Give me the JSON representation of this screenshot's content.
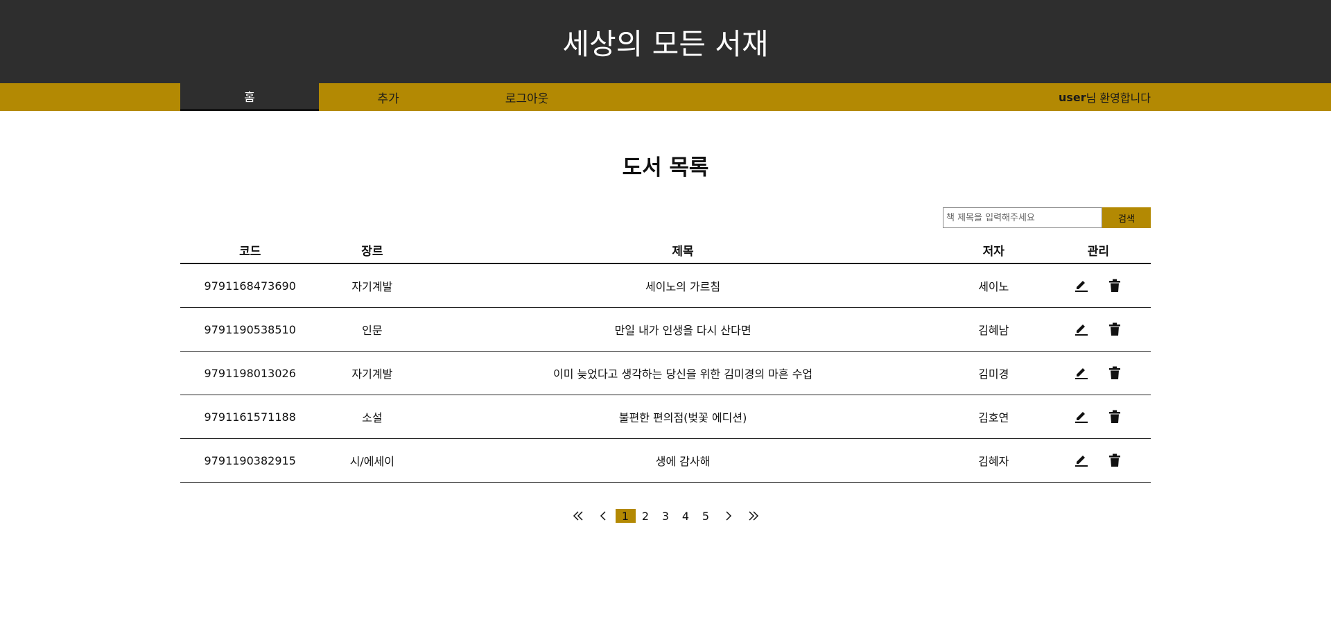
{
  "site": {
    "title": "세상의 모든 서재"
  },
  "nav": {
    "items": [
      {
        "label": "홈"
      },
      {
        "label": "추가"
      },
      {
        "label": "로그아웃"
      }
    ],
    "user": "user",
    "welcome_suffix": "님 환영합니다"
  },
  "main": {
    "heading": "도서 목록",
    "search": {
      "placeholder": "책 제목을 입력해주세요",
      "value": "",
      "button_label": "검색"
    },
    "table": {
      "headers": [
        "코드",
        "장르",
        "제목",
        "저자",
        "관리"
      ],
      "rows": [
        {
          "code": "9791168473690",
          "genre": "자기계발",
          "title": "세이노의 가르침",
          "author": "세이노"
        },
        {
          "code": "9791190538510",
          "genre": "인문",
          "title": "만일 내가 인생을 다시 산다면",
          "author": "김혜남"
        },
        {
          "code": "9791198013026",
          "genre": "자기계발",
          "title": "이미 늦었다고 생각하는 당신을 위한 김미경의 마흔 수업",
          "author": "김미경"
        },
        {
          "code": "9791161571188",
          "genre": "소설",
          "title": "불편한 편의점(벚꽃 에디션)",
          "author": "김호연"
        },
        {
          "code": "9791190382915",
          "genre": "시/에세이",
          "title": "생에 감사해",
          "author": "김혜자"
        }
      ],
      "row_icons": [
        "edit-icon",
        "trash-icon"
      ]
    },
    "pagination": {
      "pages": [
        "1",
        "2",
        "3",
        "4",
        "5"
      ],
      "current": "1",
      "icons": [
        "first-page-icon",
        "prev-page-icon",
        "next-page-icon",
        "last-page-icon"
      ]
    }
  },
  "colors": {
    "header_bg": "#2e2e2e",
    "accent": "#b38903",
    "text": "#111111"
  }
}
